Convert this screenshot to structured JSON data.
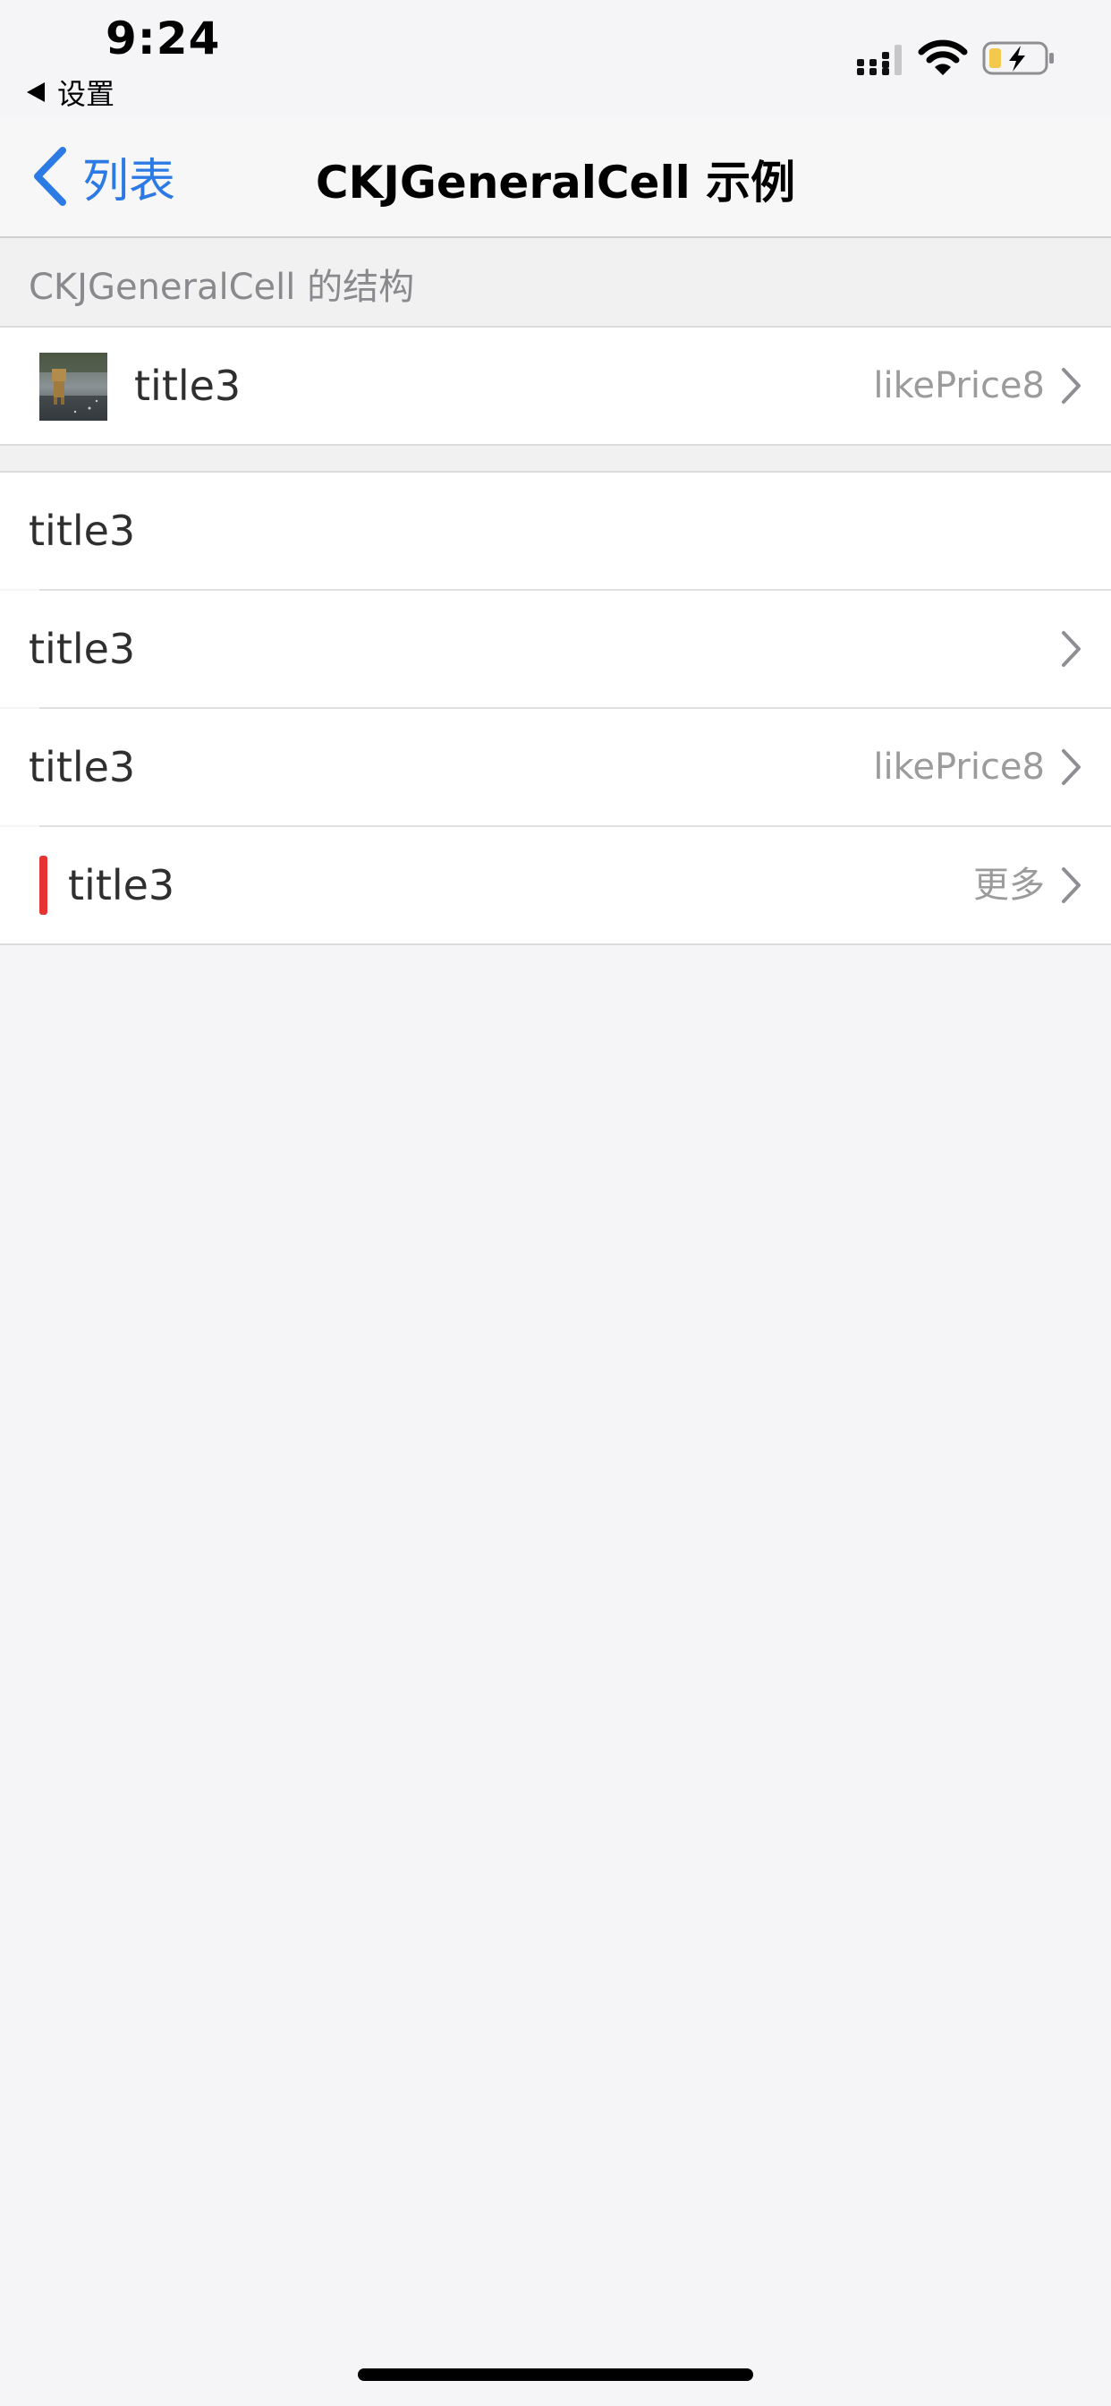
{
  "status_bar": {
    "time": "9:24",
    "back_app": "设置",
    "icons": [
      "signal-icon",
      "wifi-icon",
      "battery-charging-icon"
    ]
  },
  "nav": {
    "back_label": "列表",
    "title": "CKJGeneralCell 示例"
  },
  "section_header": "CKJGeneralCell 的结构",
  "cells": [
    {
      "title": "title3",
      "detail": "likePrice8",
      "image": "thumbnail-image",
      "chevron": true
    },
    {
      "title": "title3",
      "detail": "",
      "chevron": false
    },
    {
      "title": "title3",
      "detail": "",
      "chevron": true
    },
    {
      "title": "title3",
      "detail": "likePrice8",
      "chevron": true
    },
    {
      "title": "title3",
      "detail": "更多",
      "chevron": true,
      "marker": "red-bar"
    }
  ],
  "colors": {
    "accent": "#2c7be5",
    "background": "#f5f5f7",
    "marker_red": "#e53431",
    "detail_text": "#9b9b9b"
  }
}
